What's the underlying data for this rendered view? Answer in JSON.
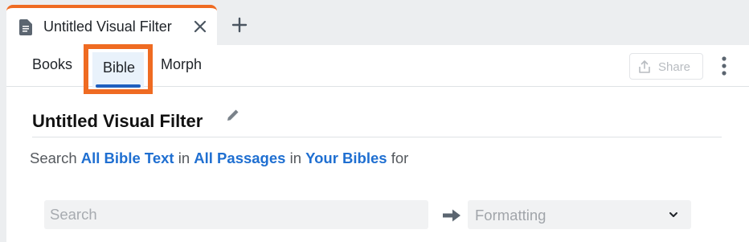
{
  "tab": {
    "title": "Untitled Visual Filter",
    "icon": "document-icon",
    "close_icon": "close-icon",
    "add_icon": "plus-icon",
    "accent_color": "#ef6b22"
  },
  "subtabs": {
    "items": [
      {
        "label": "Books"
      },
      {
        "label": "Bible",
        "selected": true
      },
      {
        "label": "Morph"
      }
    ],
    "highlight_color": "#ef6b22",
    "selected_underline_color": "#1f5fbf"
  },
  "toolbar": {
    "share_label": "Share",
    "share_icon": "share-icon",
    "more_icon": "more-vertical-icon"
  },
  "filter": {
    "title": "Untitled Visual Filter",
    "edit_icon": "pencil-icon"
  },
  "sentence": {
    "prefix": "Search",
    "text_scope": "All Bible Text",
    "in1": "in",
    "passage_scope": "All Passages",
    "in2": "in",
    "bible_scope": "Your Bibles",
    "suffix": "for",
    "link_color": "#1f6fd1"
  },
  "search": {
    "placeholder": "Search",
    "value": ""
  },
  "format": {
    "selected": "Formatting"
  }
}
